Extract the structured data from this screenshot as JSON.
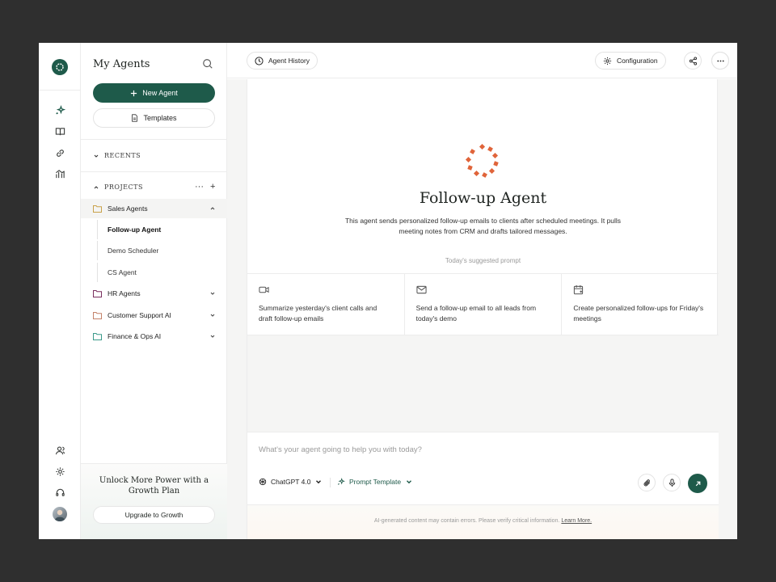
{
  "sidebar": {
    "title": "My Agents",
    "new_agent_label": "New Agent",
    "templates_label": "Templates",
    "recents_label": "RECENTS",
    "projects_label": "PROJECTS",
    "projects": [
      {
        "label": "Sales Agents",
        "folder_color": "#c9a24a",
        "expanded": true,
        "children": [
          "Follow-up Agent",
          "Demo Scheduler",
          "CS Agent"
        ]
      },
      {
        "label": "HR Agents",
        "folder_color": "#7a2f5e"
      },
      {
        "label": "Customer Support AI",
        "folder_color": "#c4826a"
      },
      {
        "label": "Finance & Ops AI",
        "folder_color": "#3b9a8a"
      }
    ],
    "promo": {
      "title": "Unlock More Power with a Growth Plan",
      "button": "Upgrade to Growth"
    }
  },
  "topbar": {
    "history_label": "Agent History",
    "config_label": "Configuration"
  },
  "agent": {
    "title": "Follow-up Agent",
    "description": "This agent sends personalized follow-up emails to clients after scheduled meetings. It pulls meeting notes from CRM and drafts tailored messages.",
    "suggested_label": "Today's suggested prompt",
    "suggestions": [
      {
        "icon": "video-icon",
        "text": "Summarize yesterday's client calls and draft follow-up emails"
      },
      {
        "icon": "mail-icon",
        "text": "Send a follow-up email to all leads from today's demo"
      },
      {
        "icon": "calendar-icon",
        "text": "Create personalized follow-ups for Friday's meetings"
      }
    ]
  },
  "composer": {
    "placeholder": "What's your agent going to help you with today?",
    "model_label": "ChatGPT 4.0",
    "template_label": "Prompt Template"
  },
  "footer": {
    "disclaimer": "AI-generated content may contain errors. Please verify critical information.",
    "learn_more": "Learn More."
  },
  "colors": {
    "accent": "#1e5a4a",
    "brand_orange": "#e0643a"
  }
}
